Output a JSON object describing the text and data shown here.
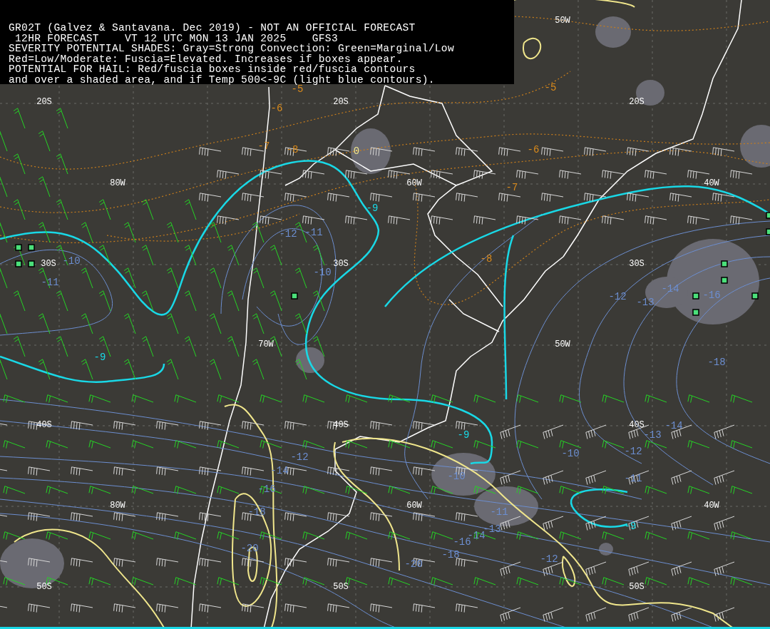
{
  "legend": {
    "lines": [
      "GR02T (Galvez & Santavana. Dec 2019) - NOT AN OFFICIAL FORECAST",
      " 12HR FORECAST    VT 12 UTC MON 13 JAN 2025    GFS3",
      "SEVERITY POTENTIAL SHADES: Gray=Strong Convection: Green=Marginal/Low",
      "Red=Low/Moderate: Fuscia=Elevated. Increases if boxes appear.",
      "POTENTIAL FOR HAIL: Red/fuscia boxes inside red/fuscia contours",
      "and over a shaded area, and if Temp 500<-9C (light blue contours)."
    ]
  },
  "grid_labels": [
    {
      "text": "50W"
    },
    {
      "text": "20S"
    },
    {
      "text": "20S"
    },
    {
      "text": "20S"
    },
    {
      "text": "80W"
    },
    {
      "text": "60W"
    },
    {
      "text": "40W"
    },
    {
      "text": "30S"
    },
    {
      "text": "30S"
    },
    {
      "text": "30S"
    },
    {
      "text": "70W"
    },
    {
      "text": "50W"
    },
    {
      "text": "40S"
    },
    {
      "text": "40S"
    },
    {
      "text": "40S"
    },
    {
      "text": "80W"
    },
    {
      "text": "60W"
    },
    {
      "text": "40W"
    },
    {
      "text": "50S"
    },
    {
      "text": "50S"
    },
    {
      "text": "50S"
    }
  ],
  "contour_labels": [
    {
      "text": "-5",
      "color": "#d98a1c"
    },
    {
      "text": "-5",
      "color": "#d98a1c"
    },
    {
      "text": "-6",
      "color": "#d98a1c"
    },
    {
      "text": "-7",
      "color": "#d98a1c"
    },
    {
      "text": "-8",
      "color": "#d98a1c"
    },
    {
      "text": "-6",
      "color": "#d98a1c"
    },
    {
      "text": "-7",
      "color": "#d98a1c"
    },
    {
      "text": "-8",
      "color": "#d98a1c"
    },
    {
      "text": "-9",
      "color": "#19d8e6"
    },
    {
      "text": "-9",
      "color": "#19d8e6"
    },
    {
      "text": "-9",
      "color": "#19d8e6"
    },
    {
      "text": "-9",
      "color": "#19d8e6"
    },
    {
      "text": "-12",
      "color": "#6c8ed0"
    },
    {
      "text": "-11",
      "color": "#6c8ed0"
    },
    {
      "text": "-10",
      "color": "#6c8ed0"
    },
    {
      "text": "-11",
      "color": "#6c8ed0"
    },
    {
      "text": "-10",
      "color": "#6c8ed0"
    },
    {
      "text": "-12",
      "color": "#6c8ed0"
    },
    {
      "text": "-13",
      "color": "#6c8ed0"
    },
    {
      "text": "-14",
      "color": "#6c8ed0"
    },
    {
      "text": "-16",
      "color": "#6c8ed0"
    },
    {
      "text": "-18",
      "color": "#6c8ed0"
    },
    {
      "text": "-13",
      "color": "#6c8ed0"
    },
    {
      "text": "-14",
      "color": "#6c8ed0"
    },
    {
      "text": "-10",
      "color": "#6c8ed0"
    },
    {
      "text": "-12",
      "color": "#6c8ed0"
    },
    {
      "text": "-11",
      "color": "#6c8ed0"
    },
    {
      "text": "-12",
      "color": "#6c8ed0"
    },
    {
      "text": "-14",
      "color": "#6c8ed0"
    },
    {
      "text": "-16",
      "color": "#6c8ed0"
    },
    {
      "text": "-18",
      "color": "#6c8ed0"
    },
    {
      "text": "-20",
      "color": "#6c8ed0"
    },
    {
      "text": "-10",
      "color": "#6c8ed0"
    },
    {
      "text": "-11",
      "color": "#6c8ed0"
    },
    {
      "text": "-13",
      "color": "#6c8ed0"
    },
    {
      "text": "-16",
      "color": "#6c8ed0"
    },
    {
      "text": "-14",
      "color": "#6c8ed0"
    },
    {
      "text": "-18",
      "color": "#6c8ed0"
    },
    {
      "text": "-20",
      "color": "#6c8ed0"
    },
    {
      "text": "-12",
      "color": "#6c8ed0"
    },
    {
      "text": "0",
      "color": "#f0e68c"
    }
  ]
}
